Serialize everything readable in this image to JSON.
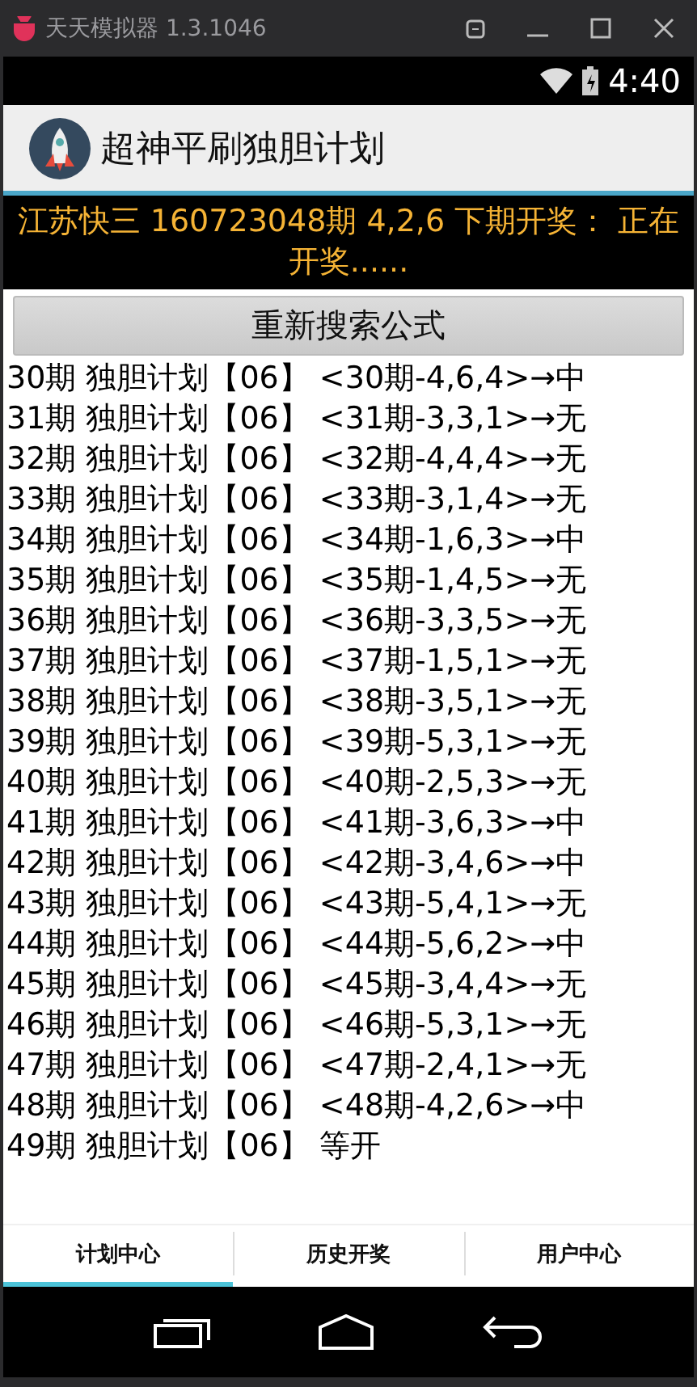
{
  "emulator": {
    "title": "天天模拟器 1.3.1046"
  },
  "status_bar": {
    "time": "4:40"
  },
  "app_bar": {
    "title": "超神平刷独胆计划"
  },
  "banner": "江苏快三 160723048期 4,2,6 下期开奖： 正在开奖......",
  "search_button": "重新搜索公式",
  "plans": [
    "30期 独胆计划【06】 <30期-4,6,4>→中",
    "31期 独胆计划【06】 <31期-3,3,1>→无",
    "32期 独胆计划【06】 <32期-4,4,4>→无",
    "33期 独胆计划【06】 <33期-3,1,4>→无",
    "34期 独胆计划【06】 <34期-1,6,3>→中",
    "35期 独胆计划【06】 <35期-1,4,5>→无",
    "36期 独胆计划【06】 <36期-3,3,5>→无",
    "37期 独胆计划【06】 <37期-1,5,1>→无",
    "38期 独胆计划【06】 <38期-3,5,1>→无",
    "39期 独胆计划【06】 <39期-5,3,1>→无",
    "40期 独胆计划【06】 <40期-2,5,3>→无",
    "41期 独胆计划【06】 <41期-3,6,3>→中",
    "42期 独胆计划【06】 <42期-3,4,6>→中",
    "43期 独胆计划【06】 <43期-5,4,1>→无",
    "44期 独胆计划【06】 <44期-5,6,2>→中",
    "45期 独胆计划【06】 <45期-3,4,4>→无",
    "46期 独胆计划【06】 <46期-5,3,1>→无",
    "47期 独胆计划【06】 <47期-2,4,1>→无",
    "48期 独胆计划【06】 <48期-4,2,6>→中",
    "49期 独胆计划【06】 等开"
  ],
  "tabs": [
    {
      "label": "计划中心",
      "selected": true
    },
    {
      "label": "历史开奖",
      "selected": false
    },
    {
      "label": "用户中心",
      "selected": false
    }
  ]
}
